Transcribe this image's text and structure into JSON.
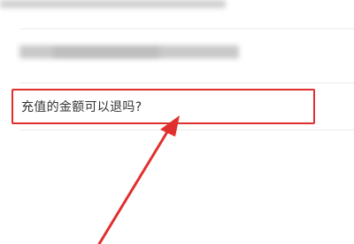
{
  "faq": {
    "items": [
      {
        "label": ""
      },
      {
        "label": ""
      },
      {
        "label": "充值的金额可以退吗?"
      }
    ]
  },
  "annotation": {
    "highlight_color": "#e0302d",
    "arrow_icon": "red-arrow-pointing-up"
  }
}
